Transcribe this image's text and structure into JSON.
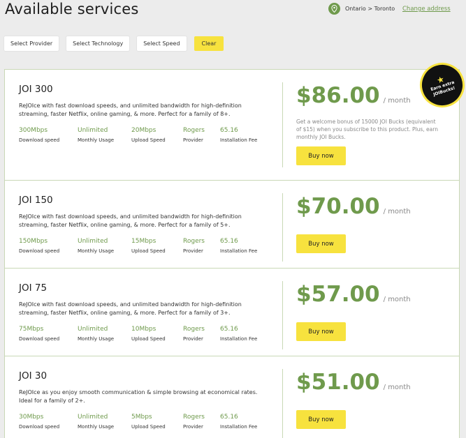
{
  "header": {
    "title": "Available services",
    "location": "Ontario > Toronto",
    "change_address": "Change address"
  },
  "filters": {
    "provider": "Select Provider",
    "technology": "Select Technology",
    "speed": "Select Speed",
    "clear": "Clear"
  },
  "badge": {
    "text": "Earn extra JOIBucks!"
  },
  "spec_labels": {
    "download": "Download speed",
    "usage": "Monthly Usage",
    "upload": "Upload Speed",
    "provider": "Provider",
    "fee": "Installation Fee"
  },
  "plans": [
    {
      "name": "JOI 300",
      "description": "ReJOIce with fast download speeds, and unlimited bandwidth for high-definition streaming, faster Netflix, online gaming, & more. Perfect for a family of 8+.",
      "download": "300Mbps",
      "usage": "Unlimited",
      "upload": "20Mbps",
      "provider": "Rogers",
      "fee": "65.16",
      "price": "$86.00",
      "per": "/ month",
      "bonus": "Get a welcome bonus of 15000 JOI Bucks (equivalent of $15) when you subscribe to this product. Plus, earn monthly JOI Bucks.",
      "buy": "Buy now"
    },
    {
      "name": "JOI 150",
      "description": "ReJOIce with fast download speeds, and unlimited bandwidth for high-definition streaming, faster Netflix, online gaming, & more. Perfect for a family of 5+.",
      "download": "150Mbps",
      "usage": "Unlimited",
      "upload": "15Mbps",
      "provider": "Rogers",
      "fee": "65.16",
      "price": "$70.00",
      "per": "/ month",
      "buy": "Buy now"
    },
    {
      "name": "JOI 75",
      "description": "ReJOIce with fast download speeds, and unlimited bandwidth for high-definition streaming, faster Netflix, online gaming, & more. Perfect for a family of 3+.",
      "download": "75Mbps",
      "usage": "Unlimited",
      "upload": "10Mbps",
      "provider": "Rogers",
      "fee": "65.16",
      "price": "$57.00",
      "per": "/ month",
      "buy": "Buy now"
    },
    {
      "name": "JOI 30",
      "description": "ReJOIce as you enjoy smooth communication & simple browsing at economical rates. Ideal for a family of 2+.",
      "download": "30Mbps",
      "usage": "Unlimited",
      "upload": "5Mbps",
      "provider": "Rogers",
      "fee": "65.16",
      "price": "$51.00",
      "per": "/ month",
      "buy": "Buy now"
    }
  ],
  "colors": {
    "accent": "#6f9a4c",
    "button": "#f7e23e",
    "border": "#c9d8b6"
  },
  "icons": {
    "location": "map-pin-icon",
    "badge": "star-icon"
  }
}
